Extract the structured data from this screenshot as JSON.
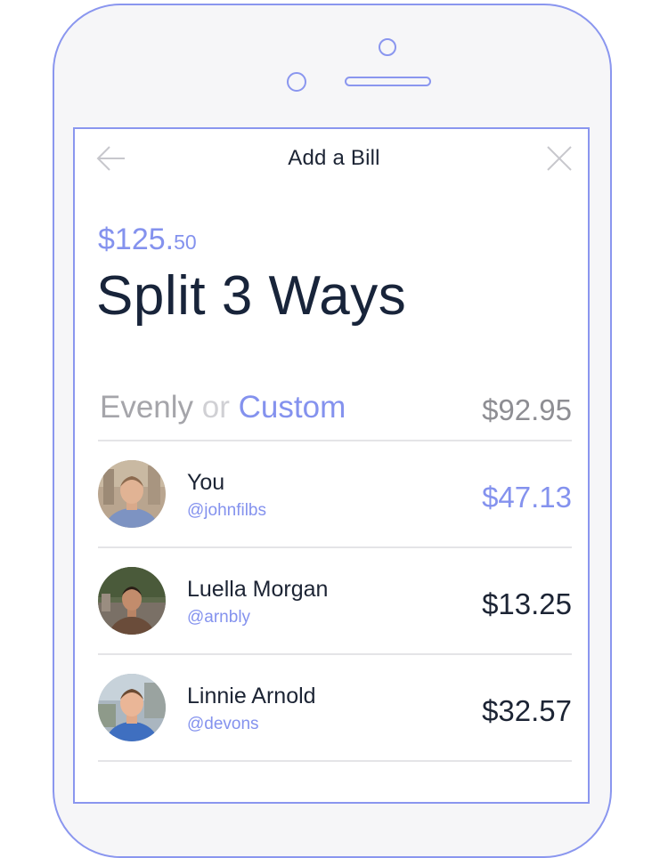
{
  "header": {
    "title": "Add a Bill",
    "back_icon": "arrow-left-icon",
    "close_icon": "close-icon"
  },
  "bill": {
    "total_dollars": "$125.",
    "total_cents": "50",
    "headline": "Split 3 Ways"
  },
  "split": {
    "evenly_label": "Evenly",
    "or_label": "or",
    "custom_label": "Custom",
    "remaining": "$92.95"
  },
  "people": [
    {
      "name": "You",
      "handle": "@johnfilbs",
      "amount": "$47.13"
    },
    {
      "name": "Luella Morgan",
      "handle": "@arnbly",
      "amount": "$13.25"
    },
    {
      "name": "Linnie Arnold",
      "handle": "@devons",
      "amount": "$32.57"
    }
  ],
  "colors": {
    "accent": "#8492ee",
    "frame": "#8a96ef",
    "text_dark": "#1c2434",
    "text_muted": "#a5a5aa"
  }
}
